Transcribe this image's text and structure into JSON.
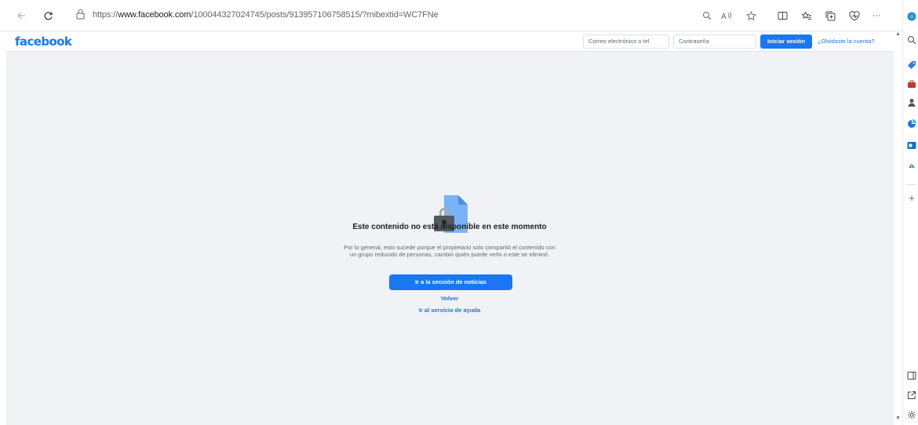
{
  "browser": {
    "url_prefix": "https://",
    "url_host": "www.facebook.com",
    "url_path": "/100044327024745/posts/913957106758515/?mibextid=WC7FNe"
  },
  "header": {
    "logo": "facebook",
    "email_placeholder": "Correo electrónico o tel",
    "password_placeholder": "Contraseña",
    "login_label": "Iniciar sesión",
    "forgot_label": "¿Olvidaste la cuenta?"
  },
  "content": {
    "title": "Este contenido no está disponible en este momento",
    "description": "Por lo general, esto sucede porque el propietario solo compartió el contenido con un grupo reducido de personas, cambió quién puede verlo o este se eliminó.",
    "primary_button": "Ir a la sección de noticias",
    "back_link": "Volver",
    "help_link": "Ir al servicio de ayuda"
  },
  "toolbar": {
    "more_label": "···"
  },
  "sidebar": {
    "add_label": "+"
  },
  "colors": {
    "brand": "#1877f2",
    "background": "#f0f2f5",
    "title_text": "#1c1e21",
    "secondary_text": "#65676b"
  }
}
